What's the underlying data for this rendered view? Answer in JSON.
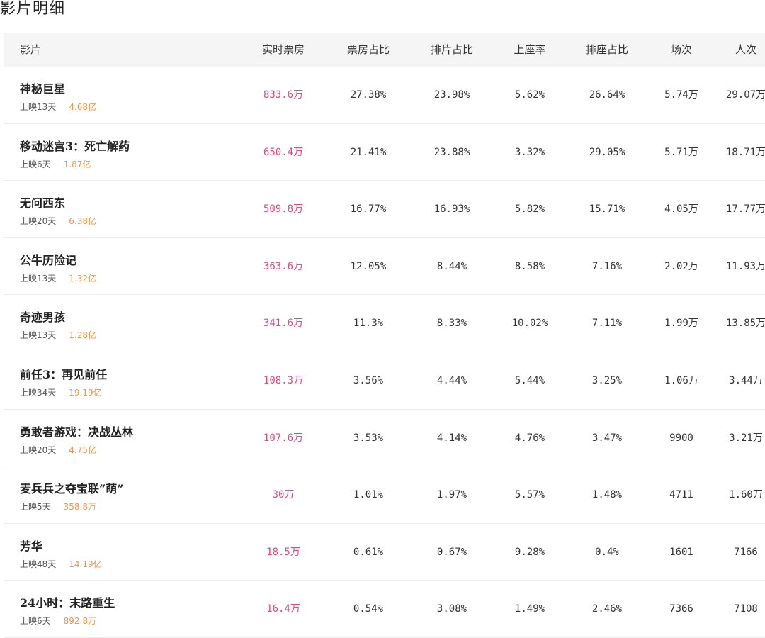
{
  "page_title": "影片明细",
  "columns": {
    "movie": "影片",
    "realtime_box": "实时票房",
    "box_share": "票房占比",
    "schedule_share": "排片占比",
    "occupancy": "上座率",
    "seat_share": "排座占比",
    "shows": "场次",
    "audience": "人次"
  },
  "rows": [
    {
      "name": "神秘巨星",
      "days": "上映13天",
      "total": "4.68亿",
      "realtime_box": "833.6万",
      "box_share": "27.38%",
      "schedule_share": "23.98%",
      "occupancy": "5.62%",
      "seat_share": "26.64%",
      "shows": "5.74万",
      "audience": "29.07万"
    },
    {
      "name": "移动迷宫3：死亡解药",
      "days": "上映6天",
      "total": "1.87亿",
      "realtime_box": "650.4万",
      "box_share": "21.41%",
      "schedule_share": "23.88%",
      "occupancy": "3.32%",
      "seat_share": "29.05%",
      "shows": "5.71万",
      "audience": "18.71万"
    },
    {
      "name": "无问西东",
      "days": "上映20天",
      "total": "6.38亿",
      "realtime_box": "509.8万",
      "box_share": "16.77%",
      "schedule_share": "16.93%",
      "occupancy": "5.82%",
      "seat_share": "15.71%",
      "shows": "4.05万",
      "audience": "17.77万"
    },
    {
      "name": "公牛历险记",
      "days": "上映13天",
      "total": "1.32亿",
      "realtime_box": "363.6万",
      "box_share": "12.05%",
      "schedule_share": "8.44%",
      "occupancy": "8.58%",
      "seat_share": "7.16%",
      "shows": "2.02万",
      "audience": "11.93万"
    },
    {
      "name": "奇迹男孩",
      "days": "上映13天",
      "total": "1.28亿",
      "realtime_box": "341.6万",
      "box_share": "11.3%",
      "schedule_share": "8.33%",
      "occupancy": "10.02%",
      "seat_share": "7.11%",
      "shows": "1.99万",
      "audience": "13.85万"
    },
    {
      "name": "前任3：再见前任",
      "days": "上映34天",
      "total": "19.19亿",
      "realtime_box": "108.3万",
      "box_share": "3.56%",
      "schedule_share": "4.44%",
      "occupancy": "5.44%",
      "seat_share": "3.25%",
      "shows": "1.06万",
      "audience": "3.44万"
    },
    {
      "name": "勇敢者游戏：决战丛林",
      "days": "上映20天",
      "total": "4.75亿",
      "realtime_box": "107.6万",
      "box_share": "3.53%",
      "schedule_share": "4.14%",
      "occupancy": "4.76%",
      "seat_share": "3.47%",
      "shows": "9900",
      "audience": "3.21万"
    },
    {
      "name": "麦兵兵之夺宝联“萌”",
      "days": "上映5天",
      "total": "358.8万",
      "realtime_box": "30万",
      "box_share": "1.01%",
      "schedule_share": "1.97%",
      "occupancy": "5.57%",
      "seat_share": "1.48%",
      "shows": "4711",
      "audience": "1.60万"
    },
    {
      "name": "芳华",
      "days": "上映48天",
      "total": "14.19亿",
      "realtime_box": "18.5万",
      "box_share": "0.61%",
      "schedule_share": "0.67%",
      "occupancy": "9.28%",
      "seat_share": "0.4%",
      "shows": "1601",
      "audience": "7166"
    },
    {
      "name": "24小时：末路重生",
      "days": "上映6天",
      "total": "892.8万",
      "realtime_box": "16.4万",
      "box_share": "0.54%",
      "schedule_share": "3.08%",
      "occupancy": "1.49%",
      "seat_share": "2.46%",
      "shows": "7366",
      "audience": "7108"
    }
  ],
  "colors": {
    "revenue": "#e8457a",
    "total": "#f0944e",
    "header_bg": "#f5f5f5"
  }
}
